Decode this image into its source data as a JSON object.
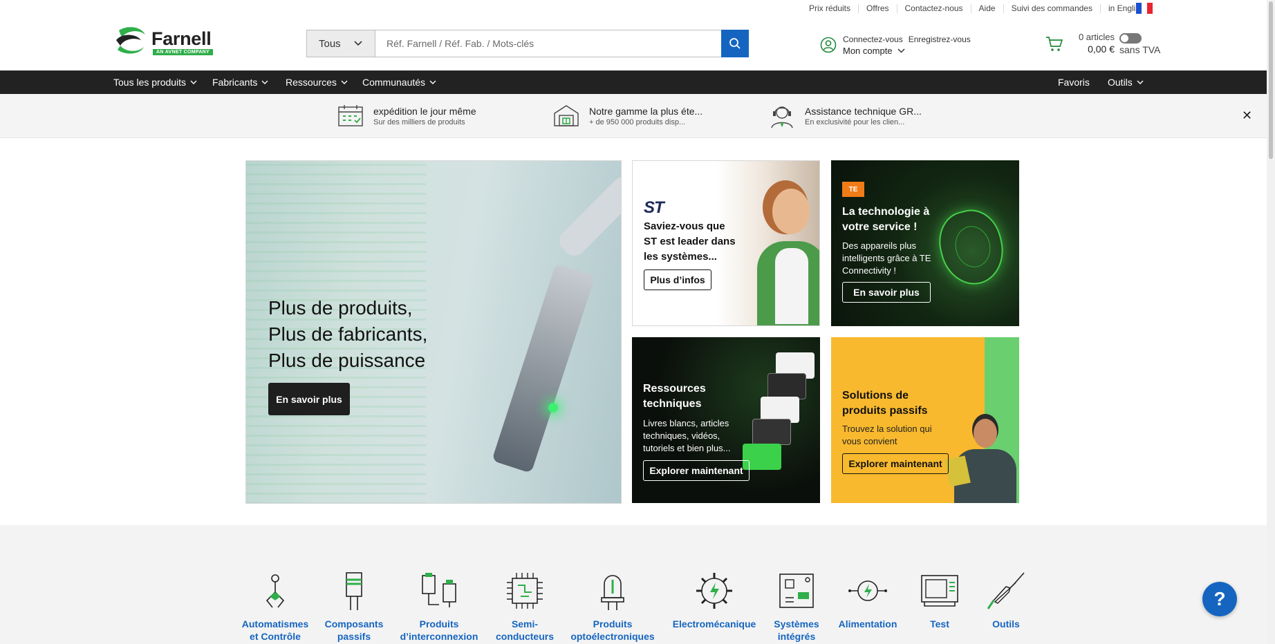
{
  "util_links": [
    "Prix réduits",
    "Offres",
    "Contactez-nous",
    "Aide",
    "Suivi des commandes",
    "in English"
  ],
  "language_flag": {
    "icon": "france-flag-icon",
    "colors": [
      "#1c4fcf",
      "#ffffff",
      "#e8242f"
    ]
  },
  "logo": {
    "name": "Farnell",
    "badge": "AN AVNET COMPANY",
    "colors": {
      "green": "#2fae4a"
    }
  },
  "search": {
    "category": "Tous",
    "placeholder": "Réf. Farnell / Réf. Fab. / Mots-clés",
    "value": "",
    "button_icon": "search-icon"
  },
  "account": {
    "login": "Connectez-vous",
    "register": "Enregistrez-vous",
    "my_account": "Mon compte"
  },
  "cart": {
    "count": "0 articles",
    "total": "0,00 €",
    "vat_label": "sans TVA",
    "vat_toggle_on": false
  },
  "nav": {
    "left": [
      "Tous les produits",
      "Fabricants",
      "Ressources",
      "Communautés"
    ],
    "favorites": "Favoris",
    "tools": "Outils"
  },
  "benefits": [
    {
      "title": "expédition le jour même",
      "sub": "Sur des milliers de produits",
      "icon": "calendar-icon"
    },
    {
      "title": "Notre gamme la plus éte...",
      "sub": "+ de 950 000 produits disp...",
      "icon": "warehouse-icon"
    },
    {
      "title": "Assistance technique GR...",
      "sub": "En exclusivité pour les clien...",
      "icon": "support-agent-icon"
    }
  ],
  "hero": {
    "lines": [
      "Plus de produits,",
      "Plus de fabricants,",
      "Plus de puissance"
    ],
    "cta": "En savoir plus"
  },
  "tiles": {
    "st": {
      "logo": "ST",
      "text": "Saviez-vous que ST est leader dans les systèmes...",
      "cta": "Plus d’infos"
    },
    "te": {
      "logo": "TE",
      "title_lines": [
        "La technologie à",
        "votre service !"
      ],
      "text": "Des appareils plus intelligents grâce à TE Connectivity !",
      "cta": "En savoir plus"
    },
    "resources": {
      "title_lines": [
        "Ressources",
        "techniques"
      ],
      "text": "Livres blancs, articles techniques, vidéos, tutoriels et bien plus...",
      "cta": "Explorer maintenant"
    },
    "passives": {
      "title_lines": [
        "Solutions de",
        "produits passifs"
      ],
      "text": "Trouvez la solution qui vous convient",
      "cta": "Explorer maintenant"
    }
  },
  "categories": [
    {
      "label": "Automatismes\net Contrôle",
      "icon": "robot-arm-icon"
    },
    {
      "label": "Composants\npassifs",
      "icon": "resistor-icon"
    },
    {
      "label": "Produits\nd’interconnexion",
      "icon": "connector-icon"
    },
    {
      "label": "Semi-\nconducteurs",
      "icon": "chip-icon"
    },
    {
      "label": "Produits\noptoélectroniques",
      "icon": "led-icon"
    },
    {
      "label": "Electromécanique",
      "icon": "gear-bolt-icon"
    },
    {
      "label": "Systèmes\nintégrés",
      "icon": "board-icon"
    },
    {
      "label": "Alimentation",
      "icon": "power-icon"
    },
    {
      "label": "Test",
      "icon": "oscilloscope-icon"
    },
    {
      "label": "Outils",
      "icon": "soldering-iron-icon"
    }
  ],
  "help": {
    "label": "?"
  },
  "colors": {
    "nav_bg": "#222222",
    "accent_blue": "#1565c0",
    "brand_green": "#2fae4a",
    "passive_yellow": "#f8b92e"
  }
}
